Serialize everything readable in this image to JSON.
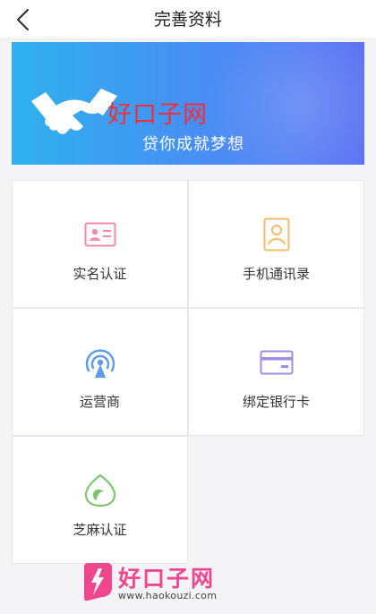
{
  "header": {
    "title": "完善资料",
    "back_icon": "chevron-left-icon"
  },
  "banner": {
    "text": "贷你成就梦想",
    "icon": "handshake-icon"
  },
  "watermarks": {
    "overlay_text": "好口子网",
    "logo_title": "好口子网",
    "logo_url": "www.haokouzi.com"
  },
  "items": [
    {
      "label": "实名认证",
      "icon": "id-card-icon",
      "color": "#f28ca6"
    },
    {
      "label": "手机通讯录",
      "icon": "contact-book-icon",
      "color": "#f2bc6a"
    },
    {
      "label": "运营商",
      "icon": "signal-tower-icon",
      "color": "#5b9bea"
    },
    {
      "label": "绑定银行卡",
      "icon": "bank-card-icon",
      "color": "#a08be6"
    },
    {
      "label": "芝麻认证",
      "icon": "sesame-leaf-icon",
      "color": "#7fc56f"
    }
  ]
}
